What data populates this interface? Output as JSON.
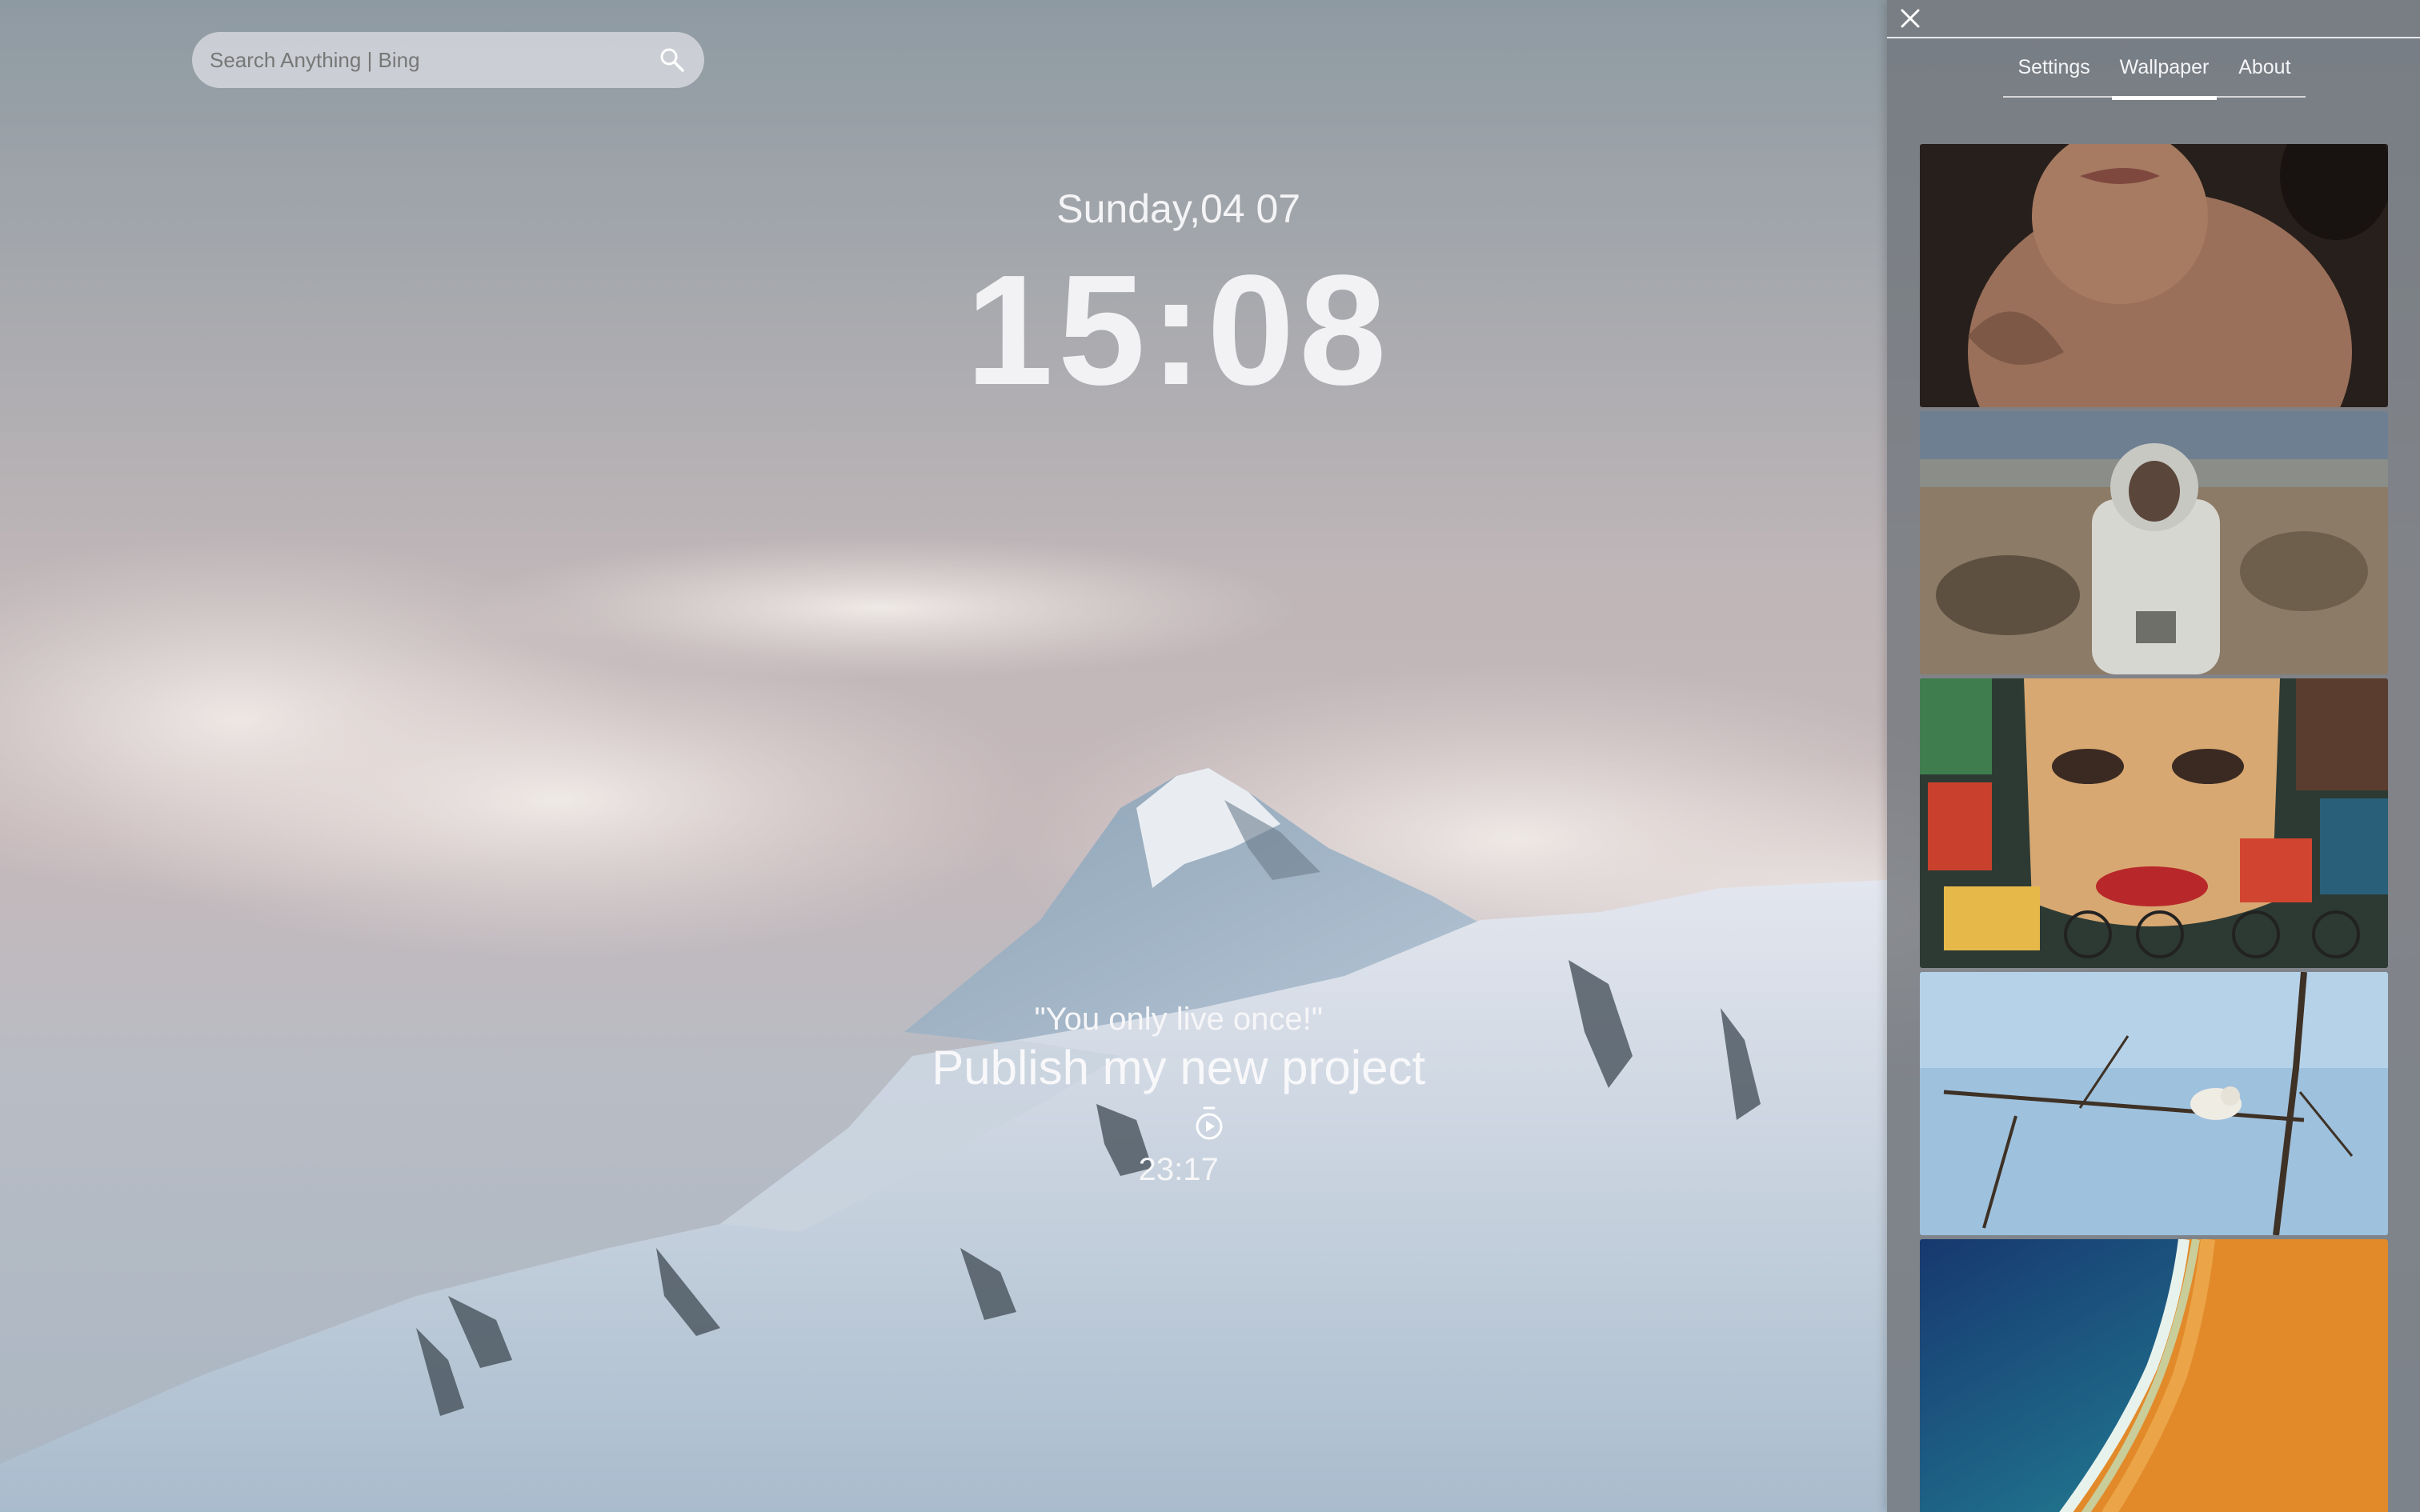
{
  "search": {
    "placeholder": "Search Anything | Bing",
    "icon": "search-icon"
  },
  "datetime": {
    "date": "Sunday,04 07",
    "time": "15:08"
  },
  "focus": {
    "quote": "\"You only live once!\"",
    "task": "Publish my new project",
    "timer_icon": "stopwatch-icon",
    "timer": "23:17"
  },
  "panel": {
    "close_icon": "close-icon",
    "tabs": [
      {
        "label": "Settings",
        "active": false
      },
      {
        "label": "Wallpaper",
        "active": true
      },
      {
        "label": "About",
        "active": false
      }
    ],
    "wallpapers": [
      {
        "name": "woman-portrait"
      },
      {
        "name": "astronaut"
      },
      {
        "name": "graffiti-mural"
      },
      {
        "name": "bird-on-branch"
      },
      {
        "name": "aerial-beach"
      }
    ]
  },
  "colors": {
    "panel_bg": "#73787e",
    "text": "#f4f4f6",
    "active_tab_underline": "#ffffff"
  }
}
